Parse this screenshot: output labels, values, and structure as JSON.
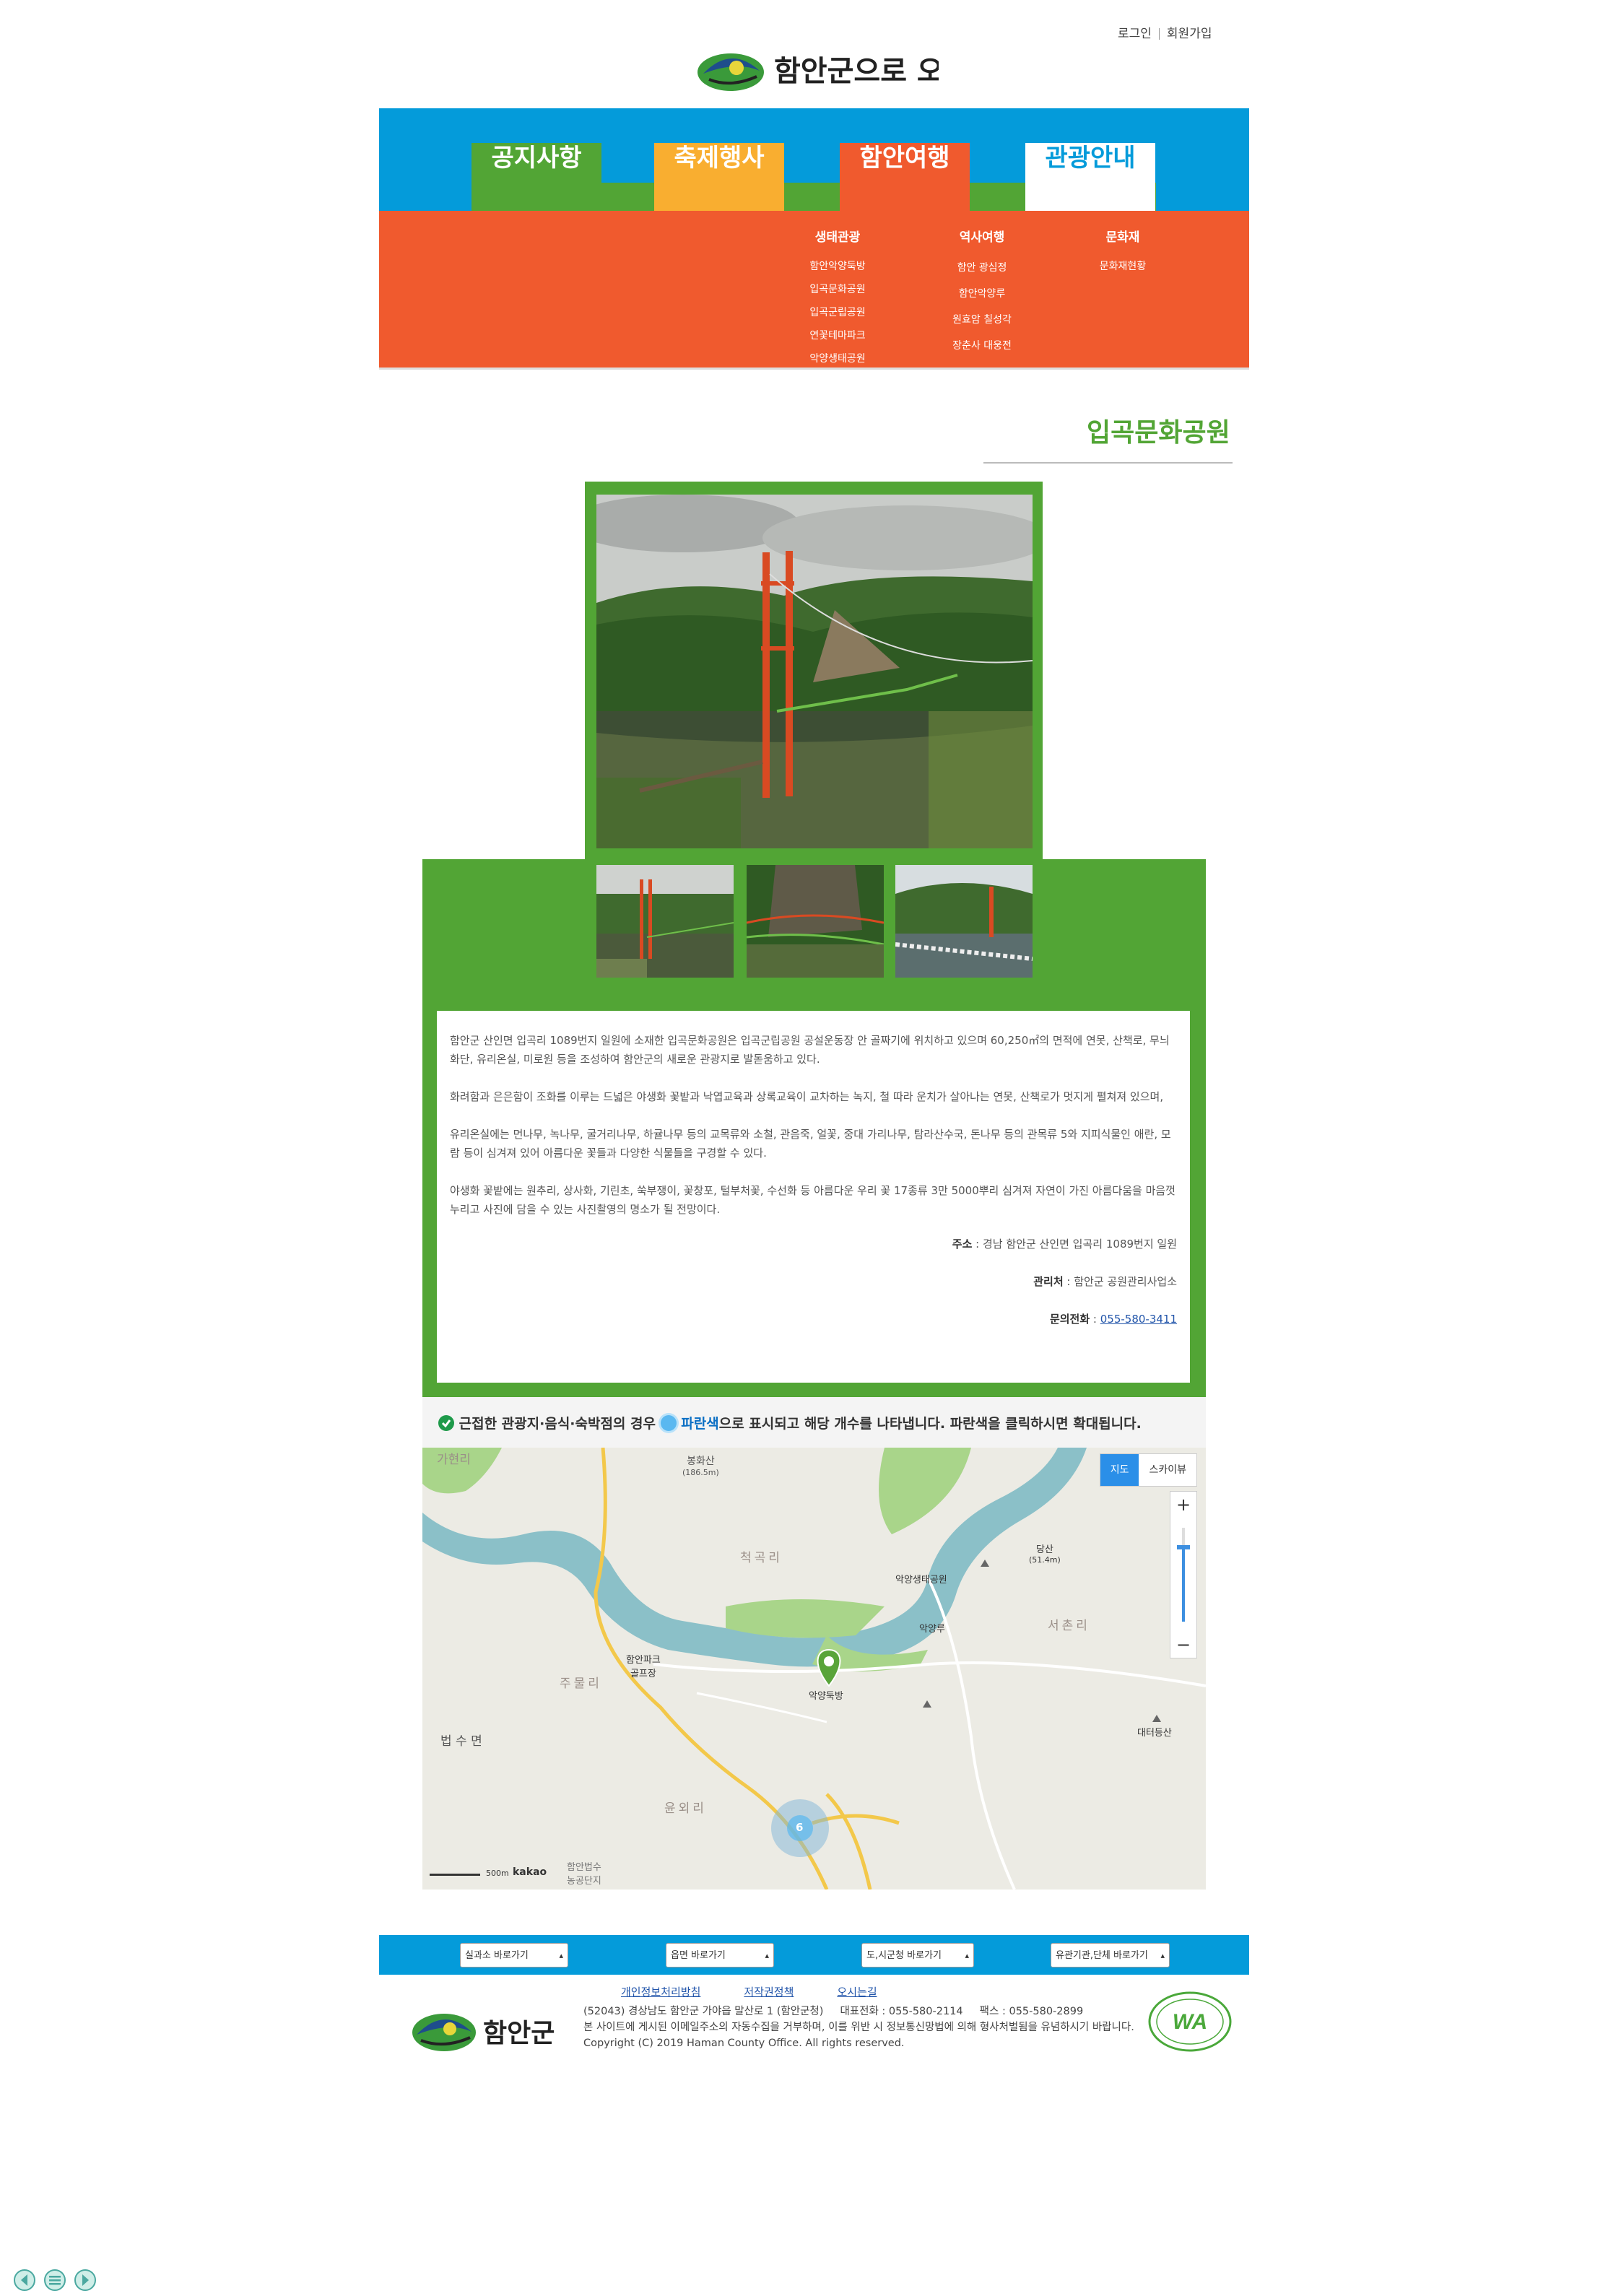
{
  "header": {
    "login": "로그인",
    "signup": "회원가입",
    "logo_text": "함안군으로 오세요"
  },
  "nav": {
    "tabs": [
      {
        "label": "공지사항",
        "color": "#52a535"
      },
      {
        "label": "축제행사",
        "color": "#f9ae30"
      },
      {
        "label": "함안여행",
        "color": "#f05a2e"
      },
      {
        "label": "관광안내",
        "color": "#ffffff"
      }
    ],
    "menu": [
      {
        "heading": "생태관광",
        "items": [
          "함안악양둑방",
          "입곡문화공원",
          "입곡군립공원",
          "연꽃테마파크",
          "악양생태공원"
        ]
      },
      {
        "heading": "역사여행",
        "items": [
          "함안 광심정",
          "함안악양루",
          "원효암 칠성각",
          "장춘사 대웅전"
        ]
      },
      {
        "heading": "문화재",
        "items": [
          "문화재현황"
        ]
      }
    ]
  },
  "page": {
    "title": "입곡문화공원"
  },
  "description": {
    "paragraphs": [
      "함안군 산인면 입곡리 1089번지 일원에 소재한 입곡문화공원은 입곡군립공원 공설운동장 안 골짜기에 위치하고 있으며 60,250㎡의 면적에 연못, 산책로, 무늬화단, 유리온실, 미로원 등을 조성하여 함안군의 새로운 관광지로 발돋움하고 있다.",
      "화려함과 은은함이 조화를 이루는 드넓은 야생화 꽃밭과 낙엽교육과 상록교육이 교차하는 녹지, 철 따라 운치가 살아나는 연못, 산책로가 멋지게 펼쳐져 있으며,",
      "유리온실에는 먼나무, 녹나무, 굴거리나무, 하귤나무 등의 교목류와 소철, 관음죽, 얼꽃, 중대 가리나무, 탐라산수국, 돈나무 등의 관목류 5와 지피식물인 애란, 모람 등이 심겨져 있어 아름다운 꽃들과 다양한 식물들을 구경할 수 있다.",
      "야생화 꽃밭에는 원추리, 상사화, 기린초, 쑥부쟁이, 꽃창포, 털부처꽃, 수선화 등 아름다운 우리 꽃 17종류 3만 5000뿌리 심겨져 자연이 가진 아름다움을 마음껏 누리고 사진에 담을 수 있는 사진촬영의 명소가 될 전망이다."
    ],
    "address_label": "주소",
    "address": " : 경남 함안군 산인면 입곡리 1089번지 일원",
    "manager_label": "관리처",
    "manager": " : 함안군 공원관리사업소",
    "phone_label": "문의전화",
    "phone_sep": " : ",
    "phone": "055-580-3411"
  },
  "notice": {
    "part1": "근접한 관광지·음식·숙박점의 경우",
    "blue": "파란색",
    "part2": "으로 표시되고 해당 개수를 나타냅니다. 파란색을 클릭하시면 확대됩니다."
  },
  "map": {
    "toggle_map": "지도",
    "toggle_sky": "스카이뷰",
    "zoom_in": "+",
    "zoom_out": "−",
    "labels": {
      "garyeon": "가현리",
      "bonghwasan": "봉화산",
      "bonghwasan_h": "(186.5m)",
      "cheokgok": "척곡리",
      "akyang_eco": "악양생태공원",
      "dangsan": "당산",
      "dangsan_h": "(51.4m)",
      "akyangru": "악양루",
      "seochon": "서촌리",
      "golf": "함안파크",
      "golf2": "골프장",
      "jumul": "주물리",
      "marker_label": "악양둑방",
      "beopsu": "법 수 면",
      "daeteo": "대터등산",
      "yunoe": "윤외리",
      "cluster": "6",
      "bottom_place": "함안법수",
      "bottom_place2": "농공단지",
      "scale": "500m",
      "brand": "kakao"
    }
  },
  "footer": {
    "selects": [
      "실과소 바로가기",
      "읍면 바로가기",
      "도,시군청 바로가기",
      "유관기관,단체 바로가기"
    ],
    "links": [
      "개인정보처리방침",
      "저작권정책",
      "오시는길"
    ],
    "address_line": "(52043) 경상남도 함안군 가야읍 말산로 1 (함안군청)     대표전화 : 055-580-2114     팩스 : 055-580-2899",
    "notice_line": "본 사이트에 게시된 이메일주소의 자동수집을 거부하며, 이를 위반 시 정보통신망법에 의해 형사처벌됨을 유념하시기 바랍니다.",
    "copyright": "Copyright (C) 2019 Haman County Office. All rights reserved.",
    "logo_text": "함안군",
    "wa_label": "WA"
  },
  "colors": {
    "blue": "#049bda",
    "green": "#52a535",
    "orange": "#f05a2e",
    "yellow": "#f9ae30"
  }
}
